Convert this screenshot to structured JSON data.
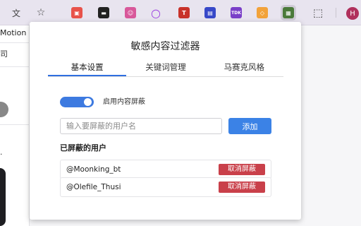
{
  "browser": {
    "extensions": [
      {
        "name": "translate-icon",
        "glyph": "文",
        "color": "#555555",
        "bg": "transparent"
      },
      {
        "name": "star-icon",
        "glyph": "☆",
        "color": "#555555",
        "bg": "transparent"
      },
      {
        "name": "ext-cube-icon",
        "glyph": "▣",
        "color": "#ffffff",
        "bg": "#e8524a"
      },
      {
        "name": "ext-terminal-icon",
        "glyph": "▬",
        "color": "#ffffff",
        "bg": "#222222"
      },
      {
        "name": "ext-pink-icon",
        "glyph": "☺",
        "color": "#ffffff",
        "bg": "#d8589a"
      },
      {
        "name": "ext-ring-icon",
        "glyph": "○",
        "color": "#9b3de0",
        "bg": "transparent"
      },
      {
        "name": "ext-t-icon",
        "glyph": "T",
        "color": "#ffffff",
        "bg": "#c8322a"
      },
      {
        "name": "ext-doc-icon",
        "glyph": "▤",
        "color": "#ffffff",
        "bg": "#3748c8"
      },
      {
        "name": "ext-tdk-icon",
        "glyph": "TDK",
        "color": "#ffffff",
        "bg": "#7a3fc8"
      },
      {
        "name": "ext-orange-icon",
        "glyph": "◇",
        "color": "#ffffff",
        "bg": "#f2a23a"
      },
      {
        "name": "ext-filter-icon",
        "glyph": "▦",
        "color": "#ffffff",
        "bg": "#4a7a3a"
      },
      {
        "name": "puzzle-icon",
        "glyph": "⬚",
        "color": "#333333",
        "bg": "transparent"
      }
    ],
    "profile_initial": "H"
  },
  "page": {
    "motion_label": "Motion",
    "frag_1": "司",
    "frag_2": "·"
  },
  "popup": {
    "title": "敏感内容过滤器",
    "tabs": [
      {
        "label": "基本设置",
        "active": true
      },
      {
        "label": "关键词管理",
        "active": false
      },
      {
        "label": "马赛克风格",
        "active": false
      }
    ],
    "toggle": {
      "label": "启用内容屏蔽",
      "enabled": true
    },
    "input": {
      "placeholder": "输入要屏蔽的用户名",
      "value": ""
    },
    "add_button": "添加",
    "blocked_title": "已屏蔽的用户",
    "blocked_users": [
      {
        "name": "@Moonking_bt",
        "action": "取消屏蔽"
      },
      {
        "name": "@Olefile_Thusi",
        "action": "取消屏蔽"
      }
    ]
  },
  "colors": {
    "accent": "#3b82e6",
    "danger": "#c9404a",
    "toggle_on": "#3d7ae0"
  }
}
